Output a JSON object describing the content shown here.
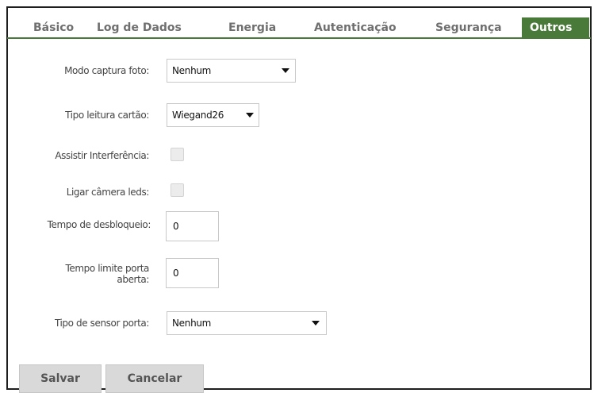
{
  "tabs": [
    {
      "label": "Básico"
    },
    {
      "label": "Log de Dados"
    },
    {
      "label": "Energia"
    },
    {
      "label": "Autenticação"
    },
    {
      "label": "Segurança"
    },
    {
      "label": "Outros",
      "active": true
    }
  ],
  "form": {
    "photo_capture_mode": {
      "label": "Modo captura foto:",
      "value": "Nenhum"
    },
    "card_read_type": {
      "label": "Tipo leitura cartão:",
      "value": "Wiegand26"
    },
    "watch_interference": {
      "label": "Assistir Interferência:",
      "checked": false
    },
    "camera_leds": {
      "label": "Ligar câmera leds:",
      "checked": false
    },
    "unlock_time": {
      "label": "Tempo de desbloqueio:",
      "value": "0"
    },
    "door_open_limit": {
      "label_line1": "Tempo limite porta",
      "label_line2": "aberta:",
      "value": "0"
    },
    "door_sensor_type": {
      "label": "Tipo de sensor porta:",
      "value": "Nenhum"
    }
  },
  "buttons": {
    "save": "Salvar",
    "cancel": "Cancelar"
  },
  "colors": {
    "accent": "#4a7a3a",
    "tab_text": "#6f6f6f",
    "button_bg": "#d9d9d9"
  }
}
